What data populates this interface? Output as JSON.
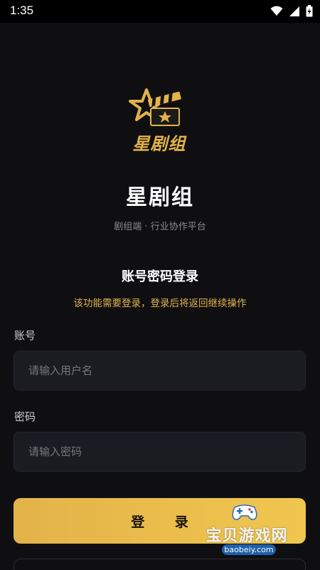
{
  "status_bar": {
    "time": "1:35"
  },
  "brand": {
    "logo_text": "星剧组",
    "app_name": "星剧组",
    "tagline": "剧组端 · 行业协作平台"
  },
  "login": {
    "heading": "账号密码登录",
    "notice": "该功能需要登录，登录后将返回继续操作",
    "account_label": "账号",
    "account_placeholder": "请输入用户名",
    "account_value": "",
    "password_label": "密码",
    "password_placeholder": "请输入密码",
    "password_value": "",
    "submit_label": "登 录"
  },
  "watermark": {
    "text": "宝贝游戏网",
    "url": "baobeiy.com"
  },
  "colors": {
    "background": "#0f0f12",
    "accent_gold": "#e0b34e",
    "input_bg": "#1b1c22"
  },
  "icons": [
    "wifi-icon",
    "signal-icon",
    "battery-icon",
    "star-clapperboard-logo"
  ]
}
